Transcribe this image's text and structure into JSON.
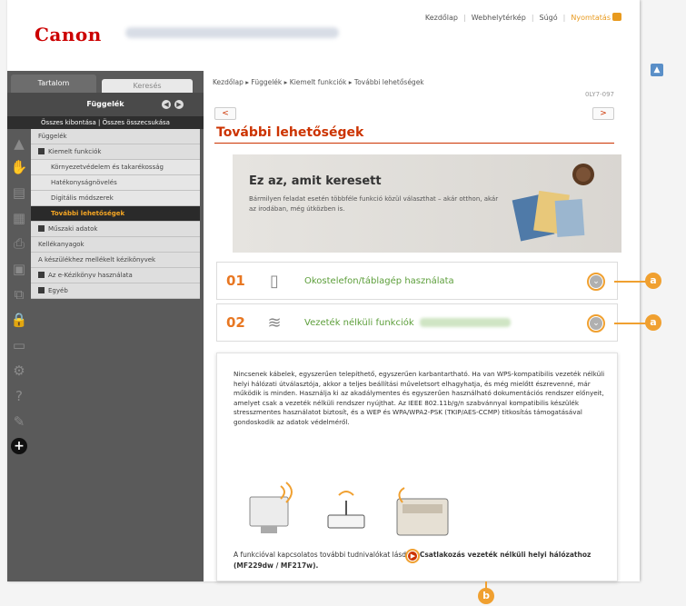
{
  "header": {
    "logo": "Canon",
    "links": [
      "Kezdőlap",
      "Webhelytérkép",
      "Súgó"
    ],
    "print_label": "Nyomtatás"
  },
  "sidebar": {
    "tab_content": "Tartalom",
    "tab_search": "Keresés",
    "section_title": "Függelék",
    "expand_all": "Összes kibontása | Összes összecsukása",
    "items": [
      {
        "label": "Függelék",
        "level": 1
      },
      {
        "label": "Kiemelt funkciók",
        "level": 1
      },
      {
        "label": "Környezetvédelem és takarékosság",
        "level": 2
      },
      {
        "label": "Hatékonyságnövelés",
        "level": 2
      },
      {
        "label": "Digitális módszerek",
        "level": 2
      },
      {
        "label": "További lehetőségek",
        "level": 2,
        "active": true
      },
      {
        "label": "Műszaki adatok",
        "level": 1
      },
      {
        "label": "Kellékanyagok",
        "level": 1
      },
      {
        "label": "A készülékhez mellékelt kézikönyvek",
        "level": 1
      },
      {
        "label": "Az e-Kézikönyv használata",
        "level": 1
      },
      {
        "label": "Egyéb",
        "level": 1
      }
    ]
  },
  "main": {
    "breadcrumb": "Kezdőlap ▸ Függelék ▸ Kiemelt funkciók ▸ További lehetőségek",
    "doc_id": "0LY7-097",
    "prev": "<",
    "next": ">",
    "title": "További lehetőségek",
    "banner_heading": "Ez az, amit keresett",
    "banner_text": "Bármilyen feladat esetén többféle funkció közül választhat – akár otthon, akár az irodában, még útközben is.",
    "features": [
      {
        "num": "01",
        "label": "Okostelefon/táblagép használata"
      },
      {
        "num": "02",
        "label": "Vezeték nélküli funkciók"
      }
    ],
    "detail_text": "Nincsenek kábelek, egyszerűen telepíthető, egyszerűen karbantartható. Ha van WPS-kompatibilis vezeték nélküli helyi hálózati útválasztója, akkor a teljes beállítási műveletsort elhagyhatja, és még mielőtt észrevenné, már működik is minden. Használja ki az akadálymentes és egyszerűen használható dokumentációs rendszer előnyeit, amelyet csak a vezeték nélküli rendszer nyújthat. Az IEEE 802.11b/g/n szabvánnyal kompatibilis készülék stresszmentes használatot biztosít, és a WEP és WPA/WPA2-PSK (TKIP/AES-CCMP) titkosítás támogatásával gondoskodik az adatok védelméről.",
    "detail_more_prefix": "A funkcióval kapcsolatos további tudnivalókat lásd",
    "detail_more_link": "Csatlakozás vezeték nélküli helyi hálózathoz (MF229dw / MF217w)."
  },
  "callouts": {
    "a": "a",
    "b": "b"
  },
  "colors": {
    "brand": "#cc0000",
    "accent": "#f0a030",
    "title": "#cc3300",
    "feature_text": "#5c9e3a"
  }
}
